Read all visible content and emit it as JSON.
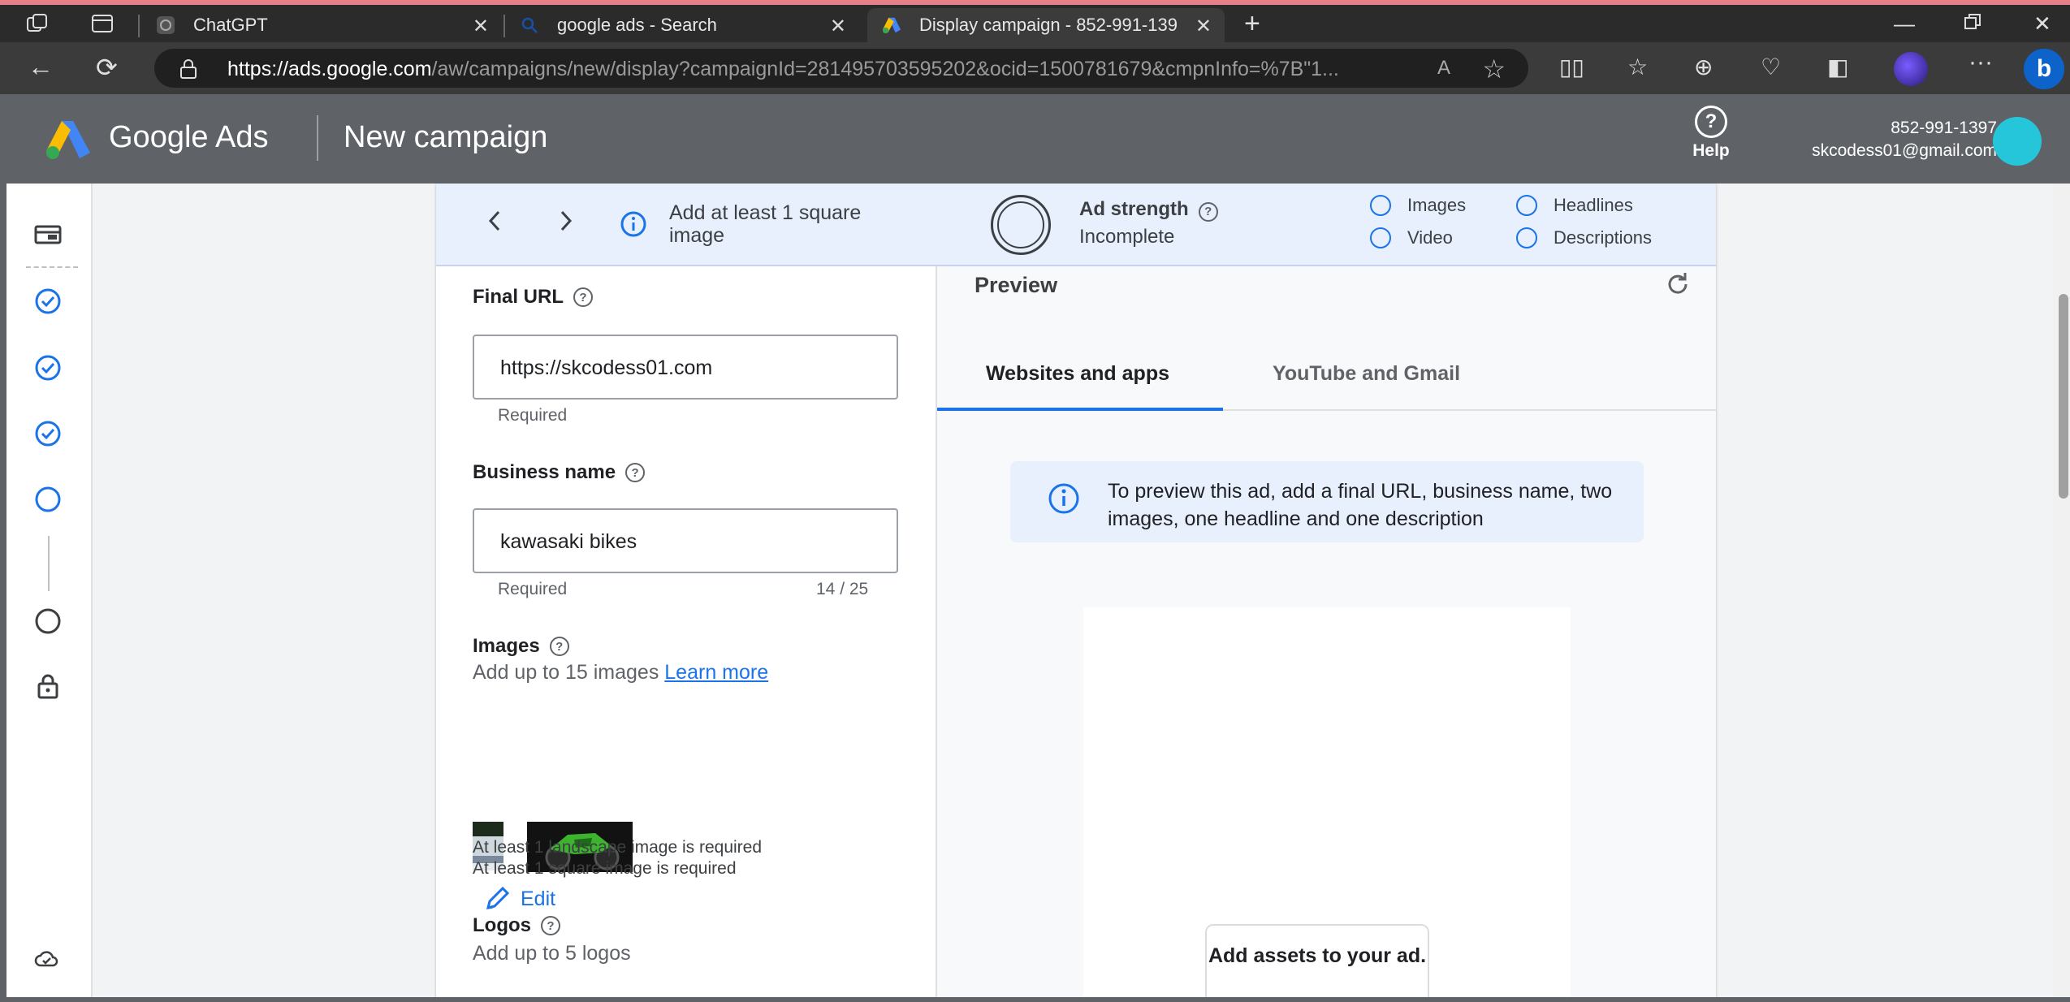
{
  "browser": {
    "tabs": [
      {
        "title": "ChatGPT"
      },
      {
        "title": "google ads - Search"
      },
      {
        "title": "Display campaign - 852-991-139"
      }
    ],
    "url_host": "https://ads.google.com",
    "url_rest": "/aw/campaigns/new/display?campaignId=281495703595202&ocid=1500781679&cmpnInfo=%7B\"1..."
  },
  "ads_header": {
    "brand": "Google Ads",
    "page_title": "New campaign",
    "help_label": "Help",
    "account_id": "852-991-1397",
    "account_email": "skcodess01@gmail.com"
  },
  "strength_bar": {
    "tip": "Add at least 1 square image",
    "title": "Ad strength",
    "status": "Incomplete",
    "checklist": [
      "Images",
      "Headlines",
      "Video",
      "Descriptions"
    ]
  },
  "form": {
    "final_url_label": "Final URL",
    "final_url_value": "https://skcodess01.com",
    "final_url_hint": "Required",
    "business_label": "Business name",
    "business_value": "kawasaki bikes",
    "business_hint": "Required",
    "business_count": "14 / 25",
    "images_label": "Images",
    "images_sub": "Add up to 15 images",
    "learn_more": "Learn more",
    "edit_label": "Edit",
    "note1": "At least 1 landscape image is required",
    "note2": "At least 1 square image is required",
    "logos_label": "Logos",
    "logos_sub": "Add up to 5 logos"
  },
  "preview": {
    "title": "Preview",
    "tabs": [
      "Websites and apps",
      "YouTube and Gmail"
    ],
    "info": "To preview this ad, add a final URL, business name, two images, one headline and one description",
    "assets_button": "Add assets to your ad."
  },
  "colors": {
    "accent": "#1a73e8",
    "header_bg": "#5f6368",
    "strength_bg": "#e8f0fe"
  }
}
